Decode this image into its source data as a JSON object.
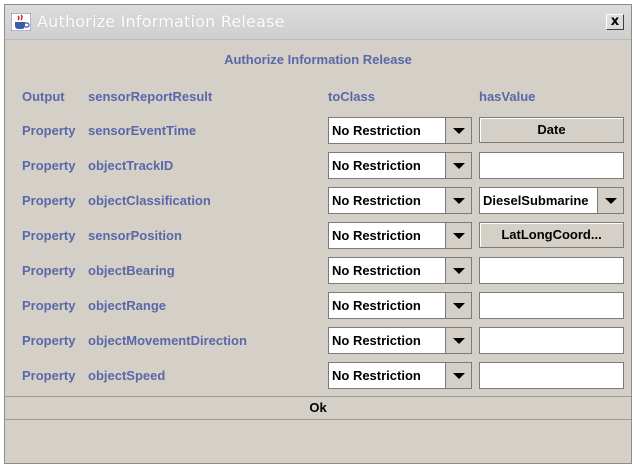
{
  "window": {
    "title": "Authorize Information Release",
    "close_glyph": "x",
    "icon": "java-coffee-cup-icon"
  },
  "dialog": {
    "heading": "Authorize Information Release"
  },
  "header": {
    "kind": "Output",
    "name": "sensorReportResult",
    "col_toclass": "toClass",
    "col_hasvalue": "hasValue"
  },
  "rows": [
    {
      "kind": "Property",
      "name": "sensorEventTime",
      "restriction": "No Restriction",
      "value_type": "button",
      "value": "Date"
    },
    {
      "kind": "Property",
      "name": "objectTrackID",
      "restriction": "No Restriction",
      "value_type": "field",
      "value": ""
    },
    {
      "kind": "Property",
      "name": "objectClassification",
      "restriction": "No Restriction",
      "value_type": "combo",
      "value": "DieselSubmarine"
    },
    {
      "kind": "Property",
      "name": "sensorPosition",
      "restriction": "No Restriction",
      "value_type": "button",
      "value": "LatLongCoord..."
    },
    {
      "kind": "Property",
      "name": "objectBearing",
      "restriction": "No Restriction",
      "value_type": "field",
      "value": ""
    },
    {
      "kind": "Property",
      "name": "objectRange",
      "restriction": "No Restriction",
      "value_type": "field",
      "value": ""
    },
    {
      "kind": "Property",
      "name": "objectMovementDirection",
      "restriction": "No Restriction",
      "value_type": "field",
      "value": ""
    },
    {
      "kind": "Property",
      "name": "objectSpeed",
      "restriction": "No Restriction",
      "value_type": "field",
      "value": ""
    }
  ],
  "footer": {
    "ok_label": "Ok"
  },
  "colors": {
    "label_blue": "#5a67a8",
    "panel_gray": "#d4d0c8"
  }
}
